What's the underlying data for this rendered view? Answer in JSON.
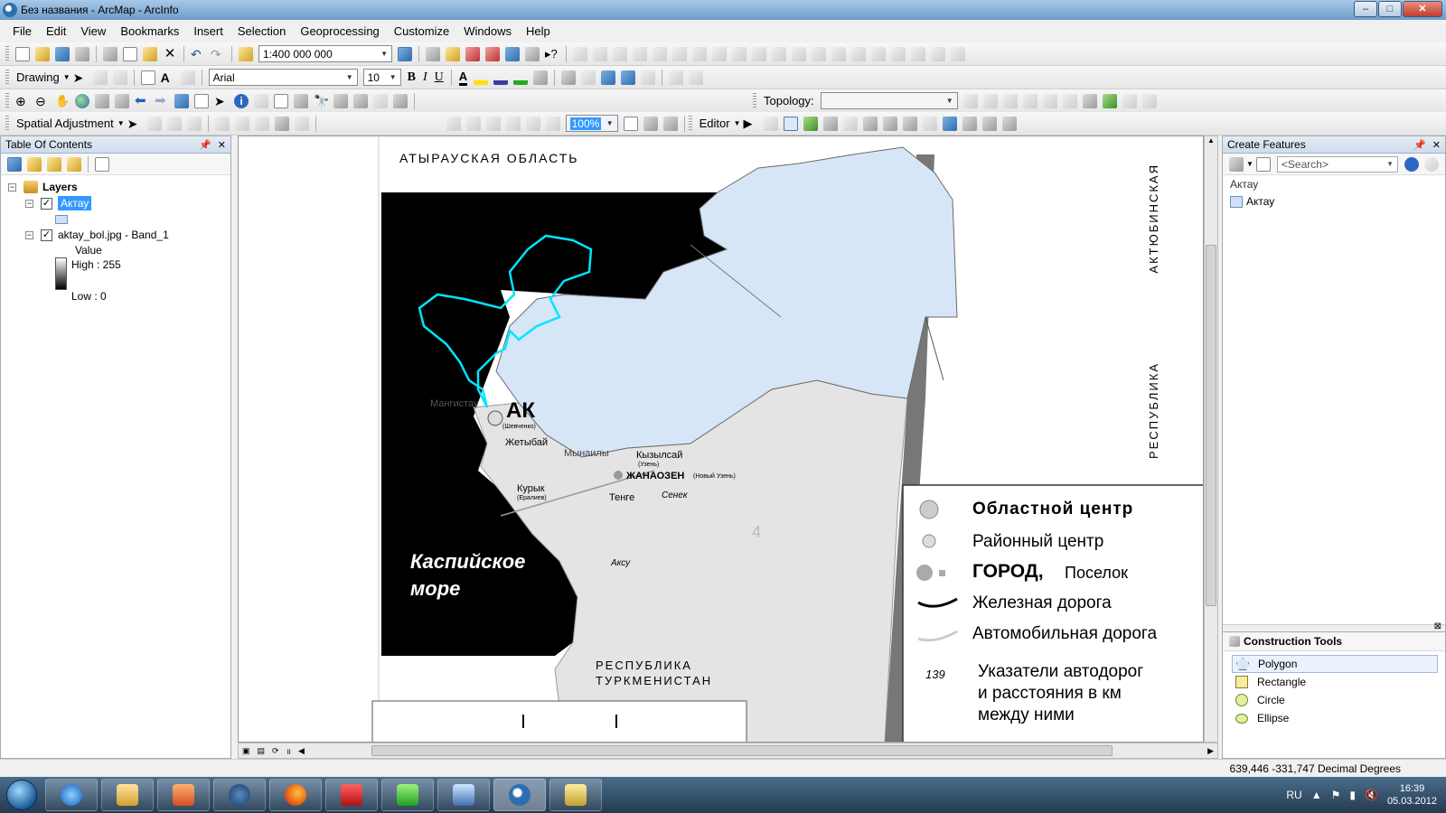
{
  "window": {
    "title": "Без названия - ArcMap - ArcInfo",
    "min": "–",
    "max": "□",
    "close": "✕"
  },
  "menu": [
    "File",
    "Edit",
    "View",
    "Bookmarks",
    "Insert",
    "Selection",
    "Geoprocessing",
    "Customize",
    "Windows",
    "Help"
  ],
  "toolbar": {
    "scale": "1:400 000 000",
    "drawing_label": "Drawing",
    "font_name": "Arial",
    "font_size": "10",
    "bold": "B",
    "italic": "I",
    "underline": "U",
    "font_color": "A",
    "topology_label": "Topology:",
    "spatial_adjustment_label": "Spatial Adjustment",
    "editor_label": "Editor",
    "zoom_value": "100%"
  },
  "toc": {
    "title": "Table Of Contents",
    "root": "Layers",
    "layer1": "Актау",
    "layer2": "aktay_bol.jpg - Band_1",
    "value_label": "Value",
    "high_label": "High : 255",
    "low_label": "Low : 0"
  },
  "map": {
    "region_top": "АТЫРАУСКАЯ ОБЛАСТЬ",
    "region_right_1": "АКТЮБИНСКАЯ",
    "region_right_2": "РЕСПУБЛИКА",
    "sea_line1": "Каспийское",
    "sea_line2": "море",
    "country_line1": "РЕСПУБЛИКА",
    "country_line2": "ТУРКМЕНИСТАН",
    "city_ak": "АК",
    "city_zhetybai": "Жетыбай",
    "city_kyzylsai": "Кызылсай",
    "city_uzen": "(Узень)",
    "city_zhanaozen": "ЖАНАОЗЕН",
    "city_zhanaozen_sub": "(Новый Узень)",
    "city_kuryk": "Курык",
    "city_kuryk_sub": "(Ералиев)",
    "city_tenge": "Тенге",
    "city_senek": "Сенек",
    "city_aksu": "Аксу",
    "city_shevchenko": "(Шевченко)",
    "city_mangystau": "Мангистау",
    "city_mynuaily": "Мынаилы",
    "num4": "4",
    "legend": [
      "Областной центр",
      "Районный центр",
      "ГОРОД,",
      "Поселок",
      "Железная дорога",
      "Автомобильная дорога",
      "139",
      "Указатели автодорог",
      "и расстояния в км",
      "между ними"
    ]
  },
  "create_features": {
    "title": "Create Features",
    "search_placeholder": "<Search>",
    "group": "Актау",
    "template": "Актау",
    "construction_title": "Construction Tools",
    "tools": [
      "Polygon",
      "Rectangle",
      "Circle",
      "Ellipse"
    ]
  },
  "status": {
    "coords": "639,446  -331,747 Decimal Degrees"
  },
  "taskbar": {
    "lang": "RU",
    "time": "16:39",
    "date": "05.03.2012"
  },
  "colors": {
    "accent": "#3399ff",
    "polygon_fill": "#d6e6f7",
    "selection_outline": "#00e5ff",
    "sea": "#000000"
  }
}
